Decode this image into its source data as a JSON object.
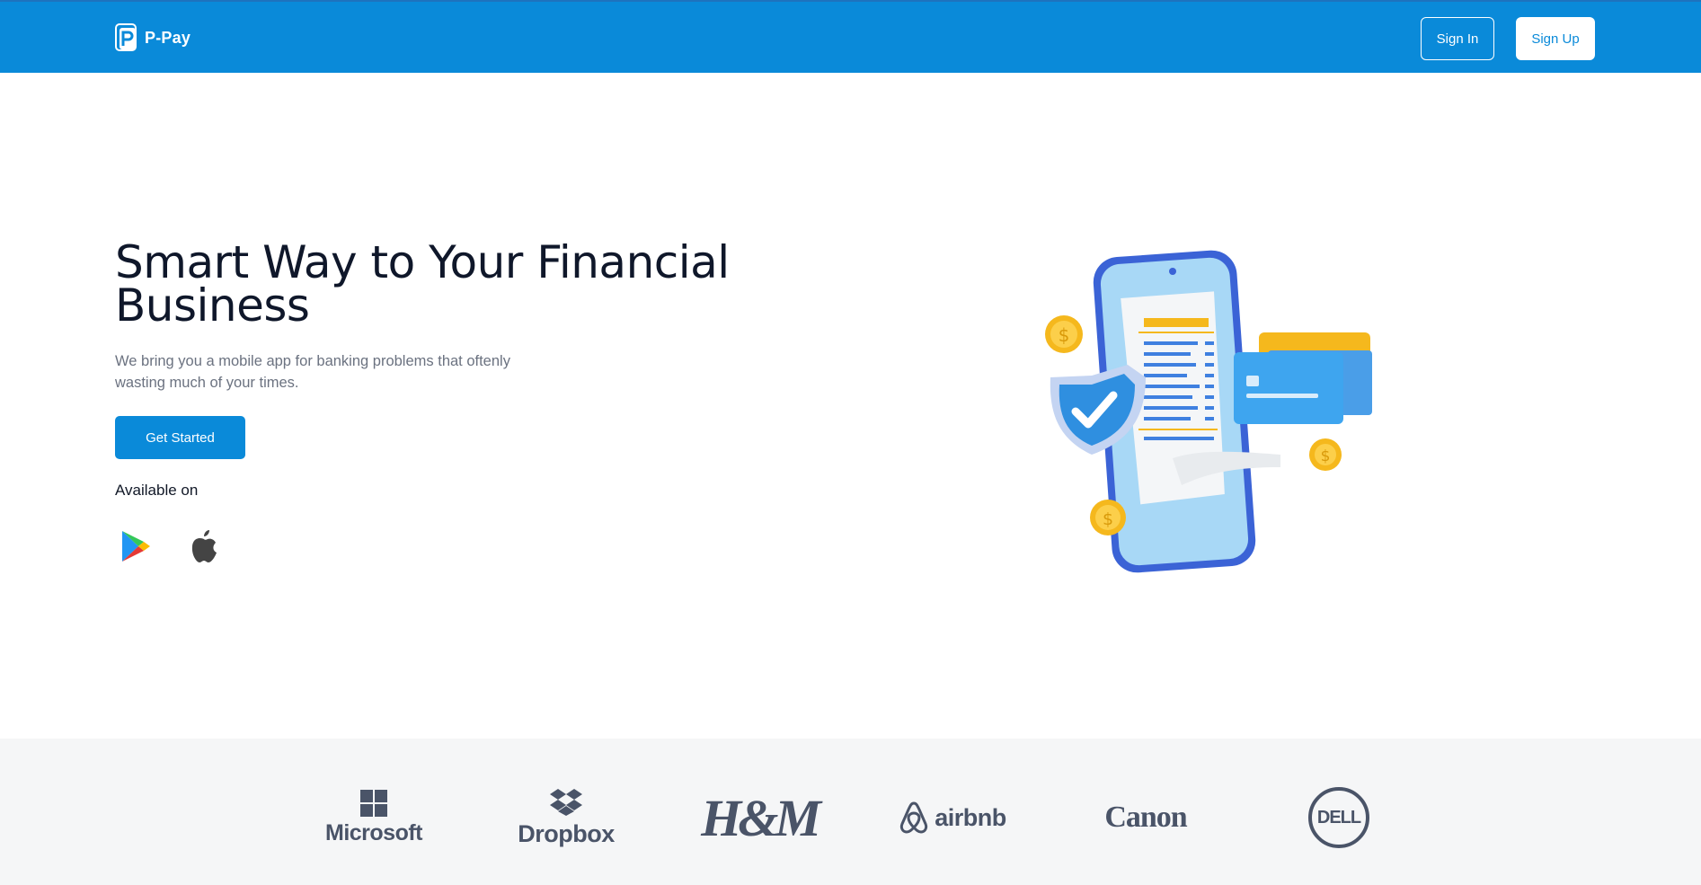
{
  "header": {
    "brand_name": "P-Pay",
    "sign_in_label": "Sign In",
    "sign_up_label": "Sign Up",
    "background_color": "#0a8ad9"
  },
  "hero": {
    "title": "Smart Way to Your Financial Business",
    "subtitle": "We bring you a mobile app for banking problems that oftenly wasting much of your times.",
    "cta_label": "Get Started",
    "available_label": "Available on",
    "stores": [
      {
        "name": "Google Play",
        "icon": "google-play-icon"
      },
      {
        "name": "App Store",
        "icon": "apple-icon"
      }
    ]
  },
  "partners": {
    "logos": [
      {
        "name": "microsoft",
        "text": "Microsoft"
      },
      {
        "name": "dropbox",
        "text": "Dropbox"
      },
      {
        "name": "hm",
        "text": "H&M"
      },
      {
        "name": "airbnb",
        "text": "airbnb"
      },
      {
        "name": "canon",
        "text": "Canon"
      },
      {
        "name": "dell",
        "text": "DELL"
      }
    ],
    "logo_color": "#4a5468",
    "background_color": "#f5f6f7"
  }
}
